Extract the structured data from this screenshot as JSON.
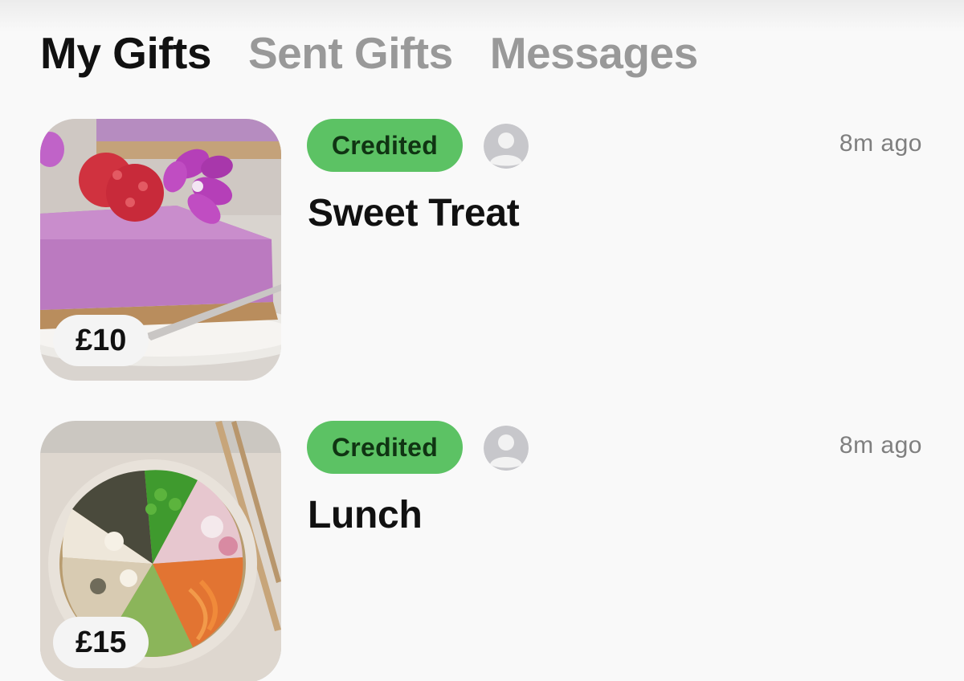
{
  "tabs": [
    {
      "label": "My Gifts",
      "active": true
    },
    {
      "label": "Sent Gifts",
      "active": false
    },
    {
      "label": "Messages",
      "active": false
    }
  ],
  "gifts": [
    {
      "title": "Sweet Treat",
      "price": "£10",
      "status": "Credited",
      "time": "8m ago",
      "image": "raspberry-cheesecake-slice-image",
      "avatar_icon": "default-user-icon"
    },
    {
      "title": "Lunch",
      "price": "£15",
      "status": "Credited",
      "time": "8m ago",
      "image": "poke-bowl-image",
      "avatar_icon": "default-user-icon"
    }
  ],
  "colors": {
    "status_green": "#5cc264",
    "active_tab": "#111111",
    "inactive_tab": "#999999",
    "time_text": "#7f7f7f"
  }
}
